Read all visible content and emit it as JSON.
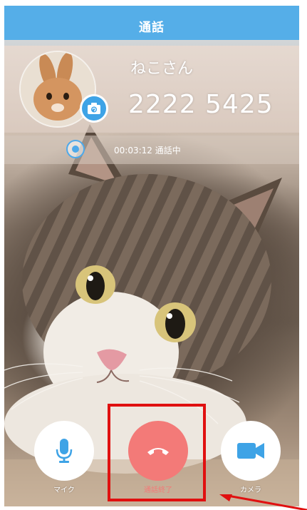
{
  "header": {
    "title": "通話"
  },
  "contact": {
    "name": "ねこさん",
    "number": "2222 5425"
  },
  "call": {
    "duration": "00:03:12",
    "status": "通話中"
  },
  "controls": {
    "mic_label": "マイク",
    "end_label": "通話終了",
    "camera_label": "カメラ"
  },
  "icons": [
    "camera-switch-icon",
    "record-icon",
    "microphone-icon",
    "hang-up-icon",
    "video-camera-icon"
  ],
  "colors": {
    "header": "#55aee8",
    "accent_blue": "#3ea3e6",
    "end_call": "#f37a78",
    "highlight": "#e01010"
  }
}
